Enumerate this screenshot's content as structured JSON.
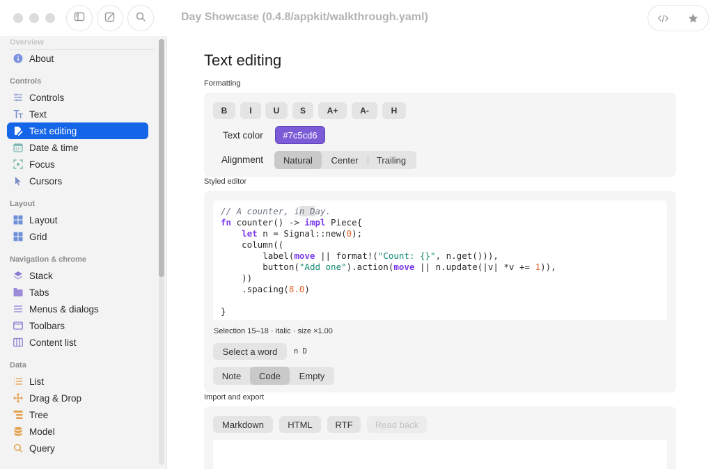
{
  "window": {
    "title": "Day Showcase (0.4.8/appkit/walkthrough.yaml)"
  },
  "toolbar": {
    "sidebar_toggle_icon": "sidebar-icon",
    "compose_icon": "compose-icon",
    "search_icon": "search-icon",
    "code_icon": "code-icon",
    "star_icon": "star-icon"
  },
  "sidebar": {
    "groups": {
      "overview": "Overview",
      "controls": "Controls",
      "layout": "Layout",
      "navigation": "Navigation & chrome",
      "data": "Data"
    },
    "items": [
      {
        "label": "About",
        "icon": "info-icon"
      },
      {
        "label": "Controls",
        "icon": "sliders-icon"
      },
      {
        "label": "Text",
        "icon": "text-icon"
      },
      {
        "label": "Text editing",
        "icon": "pencil-doc-icon"
      },
      {
        "label": "Date & time",
        "icon": "calendar-icon"
      },
      {
        "label": "Focus",
        "icon": "focus-icon"
      },
      {
        "label": "Cursors",
        "icon": "cursor-icon"
      },
      {
        "label": "Layout",
        "icon": "layout-grid-icon"
      },
      {
        "label": "Grid",
        "icon": "grid-icon"
      },
      {
        "label": "Stack",
        "icon": "stack-icon"
      },
      {
        "label": "Tabs",
        "icon": "tabs-icon"
      },
      {
        "label": "Menus & dialogs",
        "icon": "menu-icon"
      },
      {
        "label": "Toolbars",
        "icon": "toolbar-icon"
      },
      {
        "label": "Content list",
        "icon": "columns-icon"
      },
      {
        "label": "List",
        "icon": "list-icon"
      },
      {
        "label": "Drag & Drop",
        "icon": "move-icon"
      },
      {
        "label": "Tree",
        "icon": "tree-icon"
      },
      {
        "label": "Model",
        "icon": "database-icon"
      },
      {
        "label": "Query",
        "icon": "magnifier-icon"
      }
    ],
    "selected": "Text editing"
  },
  "main": {
    "title": "Text editing",
    "formatting": {
      "label": "Formatting",
      "buttons": [
        "B",
        "I",
        "U",
        "S",
        "A+",
        "A-",
        "H"
      ],
      "text_color_label": "Text color",
      "text_color_value": "#7c5cd6",
      "alignment_label": "Alignment",
      "alignment_options": [
        "Natural",
        "Center",
        "Trailing"
      ],
      "alignment_selected": "Natural"
    },
    "styled_editor": {
      "label": "Styled editor",
      "code_lines": [
        "// A counter, in Day.",
        "fn counter() -> impl Piece{",
        "    let n = Signal::new(0);",
        "    column((",
        "        label(move || format!(\"Count: {}\", n.get())),",
        "        button(\"Add one\").action(move || n.update(|v| *v += 1)),",
        "    ))",
        "    .spacing(8.0)",
        "",
        "}"
      ],
      "selection_status": "Selection 15–18 · italic · size ×1.00",
      "select_word_label": "Select a word",
      "selected_text": "n D",
      "mode_options": [
        "Note",
        "Code",
        "Empty"
      ],
      "mode_selected": "Code"
    },
    "import_export": {
      "label": "Import and export",
      "buttons": [
        "Markdown",
        "HTML",
        "RTF"
      ],
      "read_back_label": "Read back"
    }
  }
}
